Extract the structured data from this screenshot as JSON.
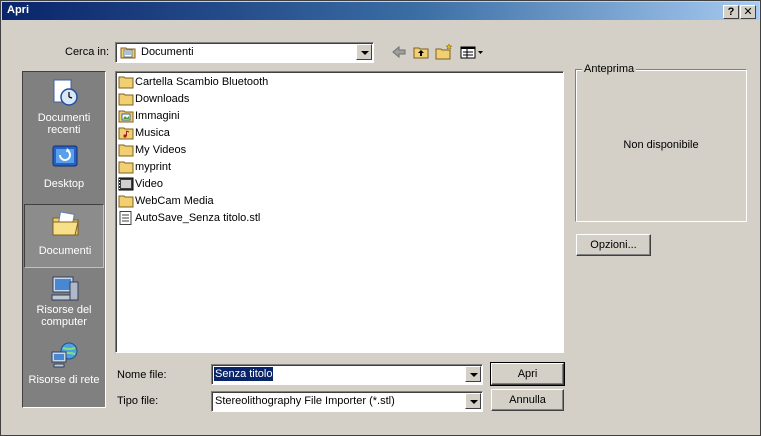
{
  "window": {
    "title": "Apri",
    "help_glyph": "?",
    "close_glyph": "✕"
  },
  "lookin": {
    "label": "Cerca in:",
    "value": "Documenti",
    "icon": "folder-documents-icon"
  },
  "toolbar": {
    "back_icon": "back-arrow-icon",
    "up_icon": "up-folder-icon",
    "new_folder_icon": "new-folder-icon",
    "view_icon": "view-menu-icon"
  },
  "places": [
    {
      "id": "recent",
      "label": "Documenti recenti",
      "icon": "recent-documents-icon"
    },
    {
      "id": "desktop",
      "label": "Desktop",
      "icon": "desktop-icon"
    },
    {
      "id": "documents",
      "label": "Documenti",
      "icon": "my-documents-icon",
      "selected": true
    },
    {
      "id": "computer",
      "label": "Risorse del computer",
      "icon": "my-computer-icon"
    },
    {
      "id": "network",
      "label": "Risorse di rete",
      "icon": "network-places-icon"
    }
  ],
  "files": [
    {
      "name": "Cartella Scambio Bluetooth",
      "icon": "folder-icon"
    },
    {
      "name": "Downloads",
      "icon": "folder-icon"
    },
    {
      "name": "Immagini",
      "icon": "folder-pictures-icon"
    },
    {
      "name": "Musica",
      "icon": "folder-music-icon"
    },
    {
      "name": "My Videos",
      "icon": "folder-icon"
    },
    {
      "name": "myprint",
      "icon": "folder-icon"
    },
    {
      "name": "Video",
      "icon": "folder-video-icon"
    },
    {
      "name": "WebCam Media",
      "icon": "folder-icon"
    },
    {
      "name": "AutoSave_Senza titolo.stl",
      "icon": "document-icon"
    }
  ],
  "preview": {
    "legend": "Anteprima",
    "status": "Non disponibile"
  },
  "options_button": "Opzioni...",
  "filename": {
    "label": "Nome file:",
    "value": "Senza titolo"
  },
  "filetype": {
    "label": "Tipo file:",
    "value": "Stereolithography File Importer (*.stl)"
  },
  "open_button": "Apri",
  "cancel_button": "Annulla",
  "colors": {
    "titlebar_start": "#0a246a",
    "titlebar_end": "#a6caf0",
    "face": "#d4d0c8",
    "places_bg": "#808080",
    "selection": "#0a246a"
  }
}
